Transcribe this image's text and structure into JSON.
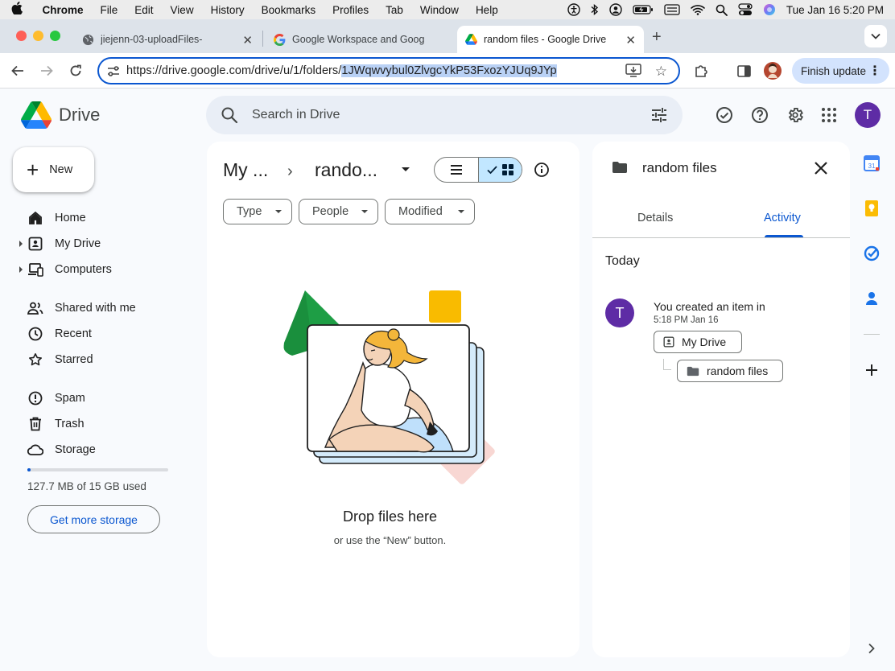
{
  "macos": {
    "app_name": "Chrome",
    "menus": [
      "File",
      "Edit",
      "View",
      "History",
      "Bookmarks",
      "Profiles",
      "Tab",
      "Window",
      "Help"
    ],
    "clock": "Tue Jan 16  5:20 PM"
  },
  "browser": {
    "tabs": [
      {
        "title": "jiejenn-03-uploadFiles-",
        "favicon": "globe-icon"
      },
      {
        "title": "Google Workspace and Goog",
        "favicon": "google-g-icon"
      },
      {
        "title": "random files - Google Drive",
        "favicon": "drive-icon",
        "active": true
      }
    ],
    "url_prefix": "https://drive.google.com/drive/u/1/folders/",
    "url_selected": "1JWqwvybul0ZlvgcYkP53FxozYJUq9JYp",
    "finish_update": "Finish update"
  },
  "drive": {
    "brand": "Drive",
    "search_placeholder": "Search in Drive",
    "avatar_letter": "T",
    "new_label": "New",
    "nav": [
      {
        "label": "Home",
        "icon": "home-icon"
      },
      {
        "label": "My Drive",
        "icon": "my-drive-icon"
      },
      {
        "label": "Computers",
        "icon": "computers-icon"
      },
      {
        "label": "Shared with me",
        "icon": "shared-icon"
      },
      {
        "label": "Recent",
        "icon": "clock-icon"
      },
      {
        "label": "Starred",
        "icon": "star-icon"
      },
      {
        "label": "Spam",
        "icon": "spam-icon"
      },
      {
        "label": "Trash",
        "icon": "trash-icon"
      },
      {
        "label": "Storage",
        "icon": "cloud-icon"
      }
    ],
    "storage_used": "127.7 MB of 15 GB used",
    "storage_fraction": 0.01,
    "get_more_storage": "Get more storage"
  },
  "main": {
    "breadcrumb_root": "My ...",
    "breadcrumb_current": "rando...",
    "filters": [
      "Type",
      "People",
      "Modified"
    ],
    "empty_title": "Drop files here",
    "empty_subtitle": "or use the “New” button."
  },
  "panel": {
    "title": "random files",
    "tabs": [
      "Details",
      "Activity"
    ],
    "active_tab": "Activity",
    "section": "Today",
    "activity": {
      "avatar_letter": "T",
      "text": "You created an item in",
      "time": "5:18 PM Jan 16",
      "parent": "My Drive",
      "child": "random files"
    }
  },
  "colors": {
    "accent": "#0b57d0",
    "avatar": "#5e2ca5",
    "selected_toggle": "#c2e7ff"
  }
}
